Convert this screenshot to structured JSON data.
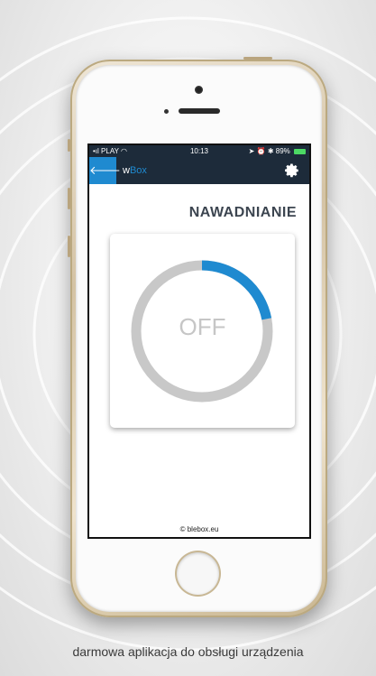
{
  "status_bar": {
    "carrier": "PLAY",
    "time": "10:13",
    "battery": "89%"
  },
  "app_bar": {
    "back_icon": "back-arrow-icon",
    "title_prefix": "w",
    "title_suffix": "Box",
    "settings_icon": "gear-icon"
  },
  "device": {
    "name": "NAWADNIANIE",
    "state": "OFF",
    "progress_fraction": 0.22
  },
  "footer": {
    "text": "© blebox.eu"
  },
  "caption": {
    "text": "darmowa aplikacja do obsługi urządzenia"
  },
  "colors": {
    "accent": "#1f8ad0",
    "appbar": "#1d2b3a",
    "ring": "#c8c8c8",
    "off_text": "#c6c6c6"
  }
}
